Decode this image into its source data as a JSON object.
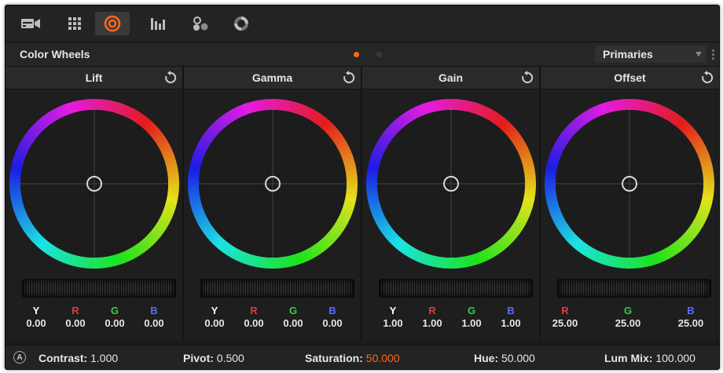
{
  "toolbar": {
    "tools": [
      {
        "icon": "camera-raw-icon"
      },
      {
        "icon": "grid-icon"
      },
      {
        "icon": "color-wheels-icon",
        "active": true
      },
      {
        "icon": "bars-icon"
      },
      {
        "icon": "nodes-icon"
      },
      {
        "icon": "rotate-icon"
      }
    ],
    "accent": "#ff6a1a"
  },
  "header": {
    "title": "Color Wheels",
    "pages": [
      {
        "active": true
      },
      {
        "active": false
      }
    ],
    "mode_select": "Primaries"
  },
  "wheels": [
    {
      "title": "Lift",
      "channels": [
        {
          "label": "Y",
          "value": "0.00"
        },
        {
          "label": "R",
          "value": "0.00"
        },
        {
          "label": "G",
          "value": "0.00"
        },
        {
          "label": "B",
          "value": "0.00"
        }
      ]
    },
    {
      "title": "Gamma",
      "channels": [
        {
          "label": "Y",
          "value": "0.00"
        },
        {
          "label": "R",
          "value": "0.00"
        },
        {
          "label": "G",
          "value": "0.00"
        },
        {
          "label": "B",
          "value": "0.00"
        }
      ]
    },
    {
      "title": "Gain",
      "channels": [
        {
          "label": "Y",
          "value": "1.00"
        },
        {
          "label": "R",
          "value": "1.00"
        },
        {
          "label": "G",
          "value": "1.00"
        },
        {
          "label": "B",
          "value": "1.00"
        }
      ]
    },
    {
      "title": "Offset",
      "channels": [
        {
          "label": "R",
          "value": "25.00"
        },
        {
          "label": "G",
          "value": "25.00"
        },
        {
          "label": "B",
          "value": "25.00"
        }
      ]
    }
  ],
  "channel_colors": {
    "Y": "#ffffff",
    "R": "#e23b3b",
    "G": "#3ec94a",
    "B": "#5a6cff"
  },
  "footer": {
    "auto_label": "A",
    "contrast": {
      "label": "Contrast:",
      "value": "1.000"
    },
    "pivot": {
      "label": "Pivot:",
      "value": "0.500"
    },
    "saturation": {
      "label": "Saturation:",
      "value": "50.000",
      "color": "#ff6a1a"
    },
    "hue": {
      "label": "Hue:",
      "value": "50.000"
    },
    "lum_mix": {
      "label": "Lum Mix:",
      "value": "100.000"
    }
  }
}
